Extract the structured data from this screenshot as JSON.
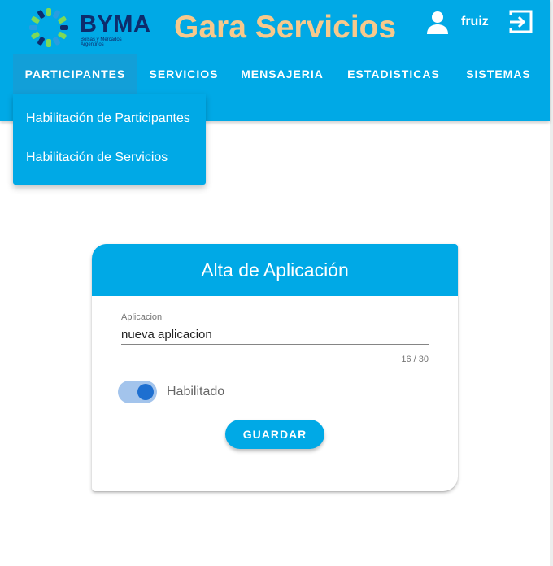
{
  "brand": {
    "logo_text": "BYMA",
    "logo_subtitle": "Bolsas y Mercados Argentinos",
    "app_title": "Gara Servicios"
  },
  "user": {
    "name": "fruiz",
    "icon": "user-icon",
    "logout_icon": "logout-icon"
  },
  "nav": {
    "items": [
      {
        "label": "PARTICIPANTES",
        "active": true
      },
      {
        "label": "SERVICIOS",
        "active": false
      },
      {
        "label": "MENSAJERIA",
        "active": false
      },
      {
        "label": "ESTADISTICAS",
        "active": false
      },
      {
        "label": "SISTEMAS",
        "active": false
      }
    ]
  },
  "dropdown": {
    "items": [
      {
        "label": "Habilitación de Participantes"
      },
      {
        "label": "Habilitación de Servicios"
      }
    ]
  },
  "card": {
    "title": "Alta de Aplicación",
    "field": {
      "label": "Aplicacion",
      "value": "nueva aplicacion",
      "counter": "16 / 30"
    },
    "toggle": {
      "label": "Habilitado",
      "checked": true
    },
    "save_label": "GUARDAR"
  },
  "colors": {
    "primary": "#00a9e6",
    "title_accent": "#f7c98c",
    "logo_navy": "#0d2c6c",
    "toggle_on": "#1e6fd0"
  }
}
